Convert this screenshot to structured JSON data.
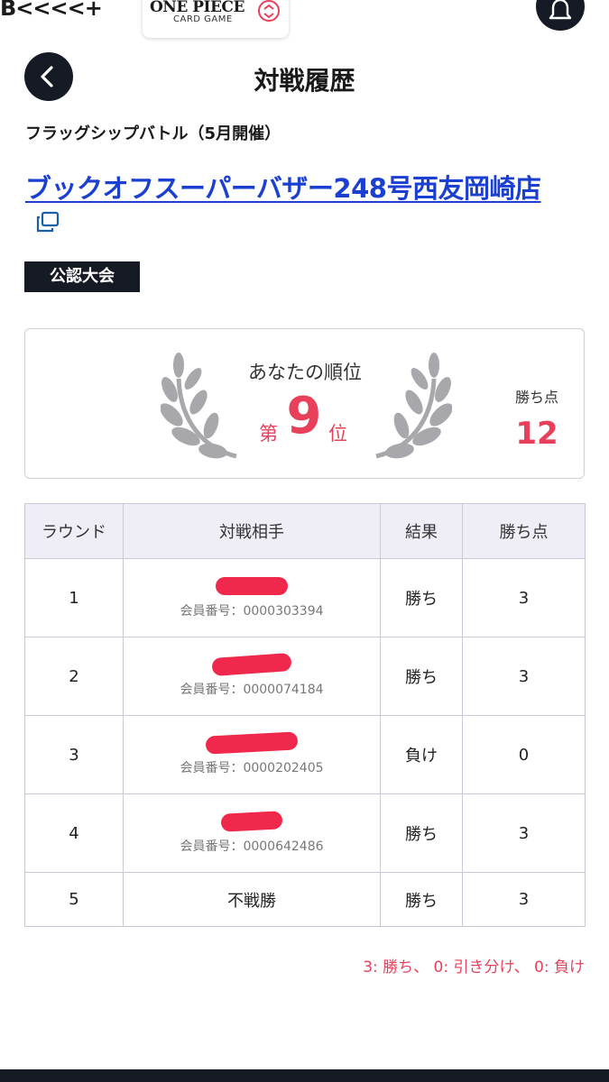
{
  "header": {
    "brand": "B<<<<+",
    "game_logo_title": "ONE PIECE",
    "game_logo_sub": "CARD GAME",
    "bell_icon": "bell-icon"
  },
  "page": {
    "title": "対戦履歴",
    "back_icon": "chevron-left-icon"
  },
  "event": {
    "name": "フラッグシップバトル（5月開催）",
    "store": "ブックオフスーパーバザー248号西友岡崎店",
    "external_link_icon": "external-link-icon",
    "badge": "公認大会"
  },
  "rank": {
    "label": "あなたの順位",
    "prefix": "第",
    "number": "9",
    "suffix": "位",
    "points_label": "勝ち点",
    "points_value": "12"
  },
  "table": {
    "headers": [
      "ラウンド",
      "対戦相手",
      "結果",
      "勝ち点"
    ],
    "rows": [
      {
        "round": "1",
        "opponent_name": "",
        "member": "会員番号：0000303394",
        "result": "勝ち",
        "points": "3"
      },
      {
        "round": "2",
        "opponent_name": "",
        "member": "会員番号：0000074184",
        "result": "勝ち",
        "points": "3"
      },
      {
        "round": "3",
        "opponent_name": "",
        "member": "会員番号：0000202405",
        "result": "負け",
        "points": "0"
      },
      {
        "round": "4",
        "opponent_name": "",
        "member": "会員番号：0000642486",
        "result": "勝ち",
        "points": "3"
      },
      {
        "round": "5",
        "opponent_name": "不戦勝",
        "member": "",
        "result": "勝ち",
        "points": "3"
      }
    ]
  },
  "legend": "3: 勝ち、 0: 引き分け、 0: 負け",
  "colors": {
    "accent": "#e8405a",
    "dark": "#161a24",
    "link": "#1b3fd0",
    "redaction": "#f0284c"
  }
}
